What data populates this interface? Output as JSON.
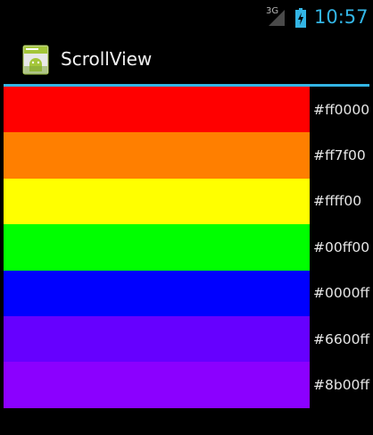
{
  "status_bar": {
    "network_type": "3G",
    "time": "10:57",
    "accent_color": "#33b5e5"
  },
  "action_bar": {
    "title": "ScrollView",
    "icon": "android-app-icon",
    "divider_color": "#33b5e5"
  },
  "colors": [
    {
      "hex": "#ff0000",
      "label": "#ff0000"
    },
    {
      "hex": "#ff7f00",
      "label": "#ff7f00"
    },
    {
      "hex": "#ffff00",
      "label": "#ffff00"
    },
    {
      "hex": "#00ff00",
      "label": "#00ff00"
    },
    {
      "hex": "#0000ff",
      "label": "#0000ff"
    },
    {
      "hex": "#6600ff",
      "label": "#6600ff"
    },
    {
      "hex": "#8b00ff",
      "label": "#8b00ff"
    }
  ]
}
